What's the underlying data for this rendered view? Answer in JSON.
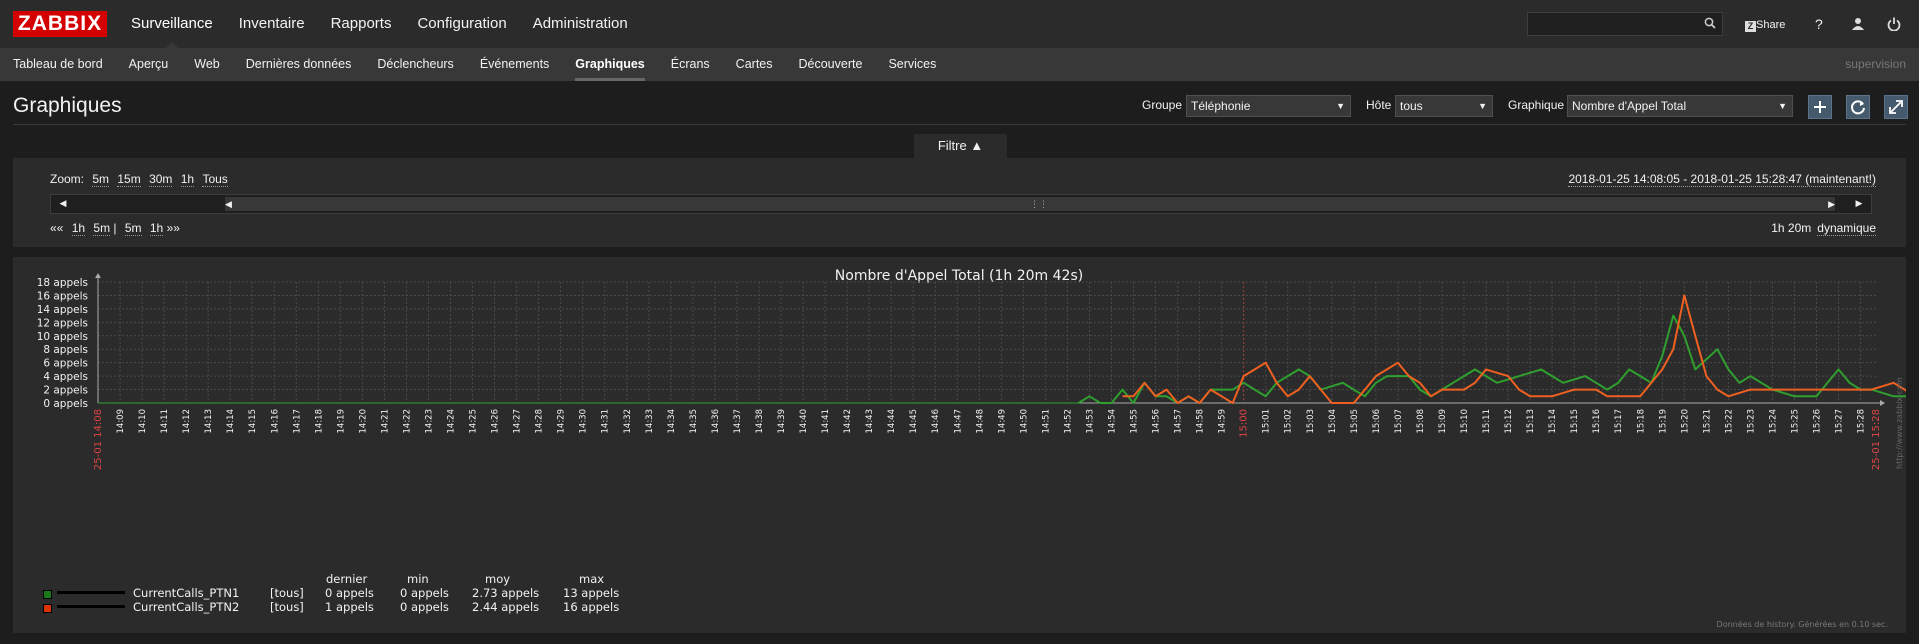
{
  "topbar": {
    "logo": "ZABBIX",
    "menu": [
      "Surveillance",
      "Inventaire",
      "Rapports",
      "Configuration",
      "Administration"
    ],
    "share": "Share",
    "help": "?"
  },
  "submenu": {
    "items": [
      "Tableau de bord",
      "Aperçu",
      "Web",
      "Dernières données",
      "Déclencheurs",
      "Événements",
      "Graphiques",
      "Écrans",
      "Cartes",
      "Découverte",
      "Services"
    ],
    "active": "Graphiques",
    "user": "supervision"
  },
  "header": {
    "title": "Graphiques",
    "group_label": "Groupe",
    "group_value": "Téléphonie",
    "host_label": "Hôte",
    "host_value": "tous",
    "graph_label": "Graphique",
    "graph_value": "Nombre d'Appel Total"
  },
  "filter": {
    "tab_label": "Filtre ▲",
    "zoom_label": "Zoom:",
    "zoom": [
      "5m",
      "15m",
      "30m",
      "1h",
      "Tous"
    ],
    "period": "2018-01-25 14:08:05 - 2018-01-25 15:28:47 (maintenant!)",
    "nav_back": "«« ",
    "nav_left": [
      "1h",
      "5m"
    ],
    "nav_sep": " | ",
    "nav_right": [
      "5m",
      "1h"
    ],
    "nav_fwd": " »»",
    "duration": "1h 20m",
    "mode": "dynamique"
  },
  "chart_data": {
    "type": "line",
    "title": "Nombre d'Appel Total (1h 20m 42s)",
    "y_unit": "appels",
    "ylim": [
      0,
      18
    ],
    "y_ticks": [
      "0 appels",
      "2 appels",
      "4 appels",
      "6 appels",
      "8 appels",
      "10 appels",
      "12 appels",
      "14 appels",
      "16 appels",
      "18 appels"
    ],
    "x_start_label": "25-01 14:08",
    "x_end_label": "25-01 15:28",
    "x_ticks": [
      "14:09",
      "14:10",
      "14:11",
      "14:12",
      "14:13",
      "14:14",
      "14:15",
      "14:16",
      "14:17",
      "14:18",
      "14:19",
      "14:20",
      "14:21",
      "14:22",
      "14:23",
      "14:24",
      "14:25",
      "14:26",
      "14:27",
      "14:28",
      "14:29",
      "14:30",
      "14:31",
      "14:32",
      "14:33",
      "14:34",
      "14:35",
      "14:36",
      "14:37",
      "14:38",
      "14:39",
      "14:40",
      "14:41",
      "14:42",
      "14:43",
      "14:44",
      "14:45",
      "14:46",
      "14:47",
      "14:48",
      "14:49",
      "14:50",
      "14:51",
      "14:52",
      "14:53",
      "14:54",
      "14:55",
      "14:56",
      "14:57",
      "14:58",
      "14:59",
      "15:00",
      "15:01",
      "15:02",
      "15:03",
      "15:04",
      "15:05",
      "15:06",
      "15:07",
      "15:08",
      "15:09",
      "15:10",
      "15:11",
      "15:12",
      "15:13",
      "15:14",
      "15:15",
      "15:16",
      "15:17",
      "15:18",
      "15:19",
      "15:20",
      "15:21",
      "15:22",
      "15:23",
      "15:24",
      "15:25",
      "15:26",
      "15:27",
      "15:28"
    ],
    "highlight_tick": "15:00",
    "grid": true,
    "watermark": "http://www.zabbix.com",
    "series": [
      {
        "name": "CurrentCalls_PTN1",
        "color": "#2f9f2f",
        "points": [
          [
            44.5,
            0
          ],
          [
            45,
            1
          ],
          [
            45.5,
            0
          ],
          [
            46,
            0
          ],
          [
            46.5,
            2
          ],
          [
            47,
            0
          ],
          [
            47.5,
            3
          ],
          [
            48,
            1
          ],
          [
            48.5,
            1
          ],
          [
            49,
            0
          ],
          [
            49.5,
            1
          ],
          [
            50,
            0
          ],
          [
            50.5,
            2
          ],
          [
            51,
            2
          ],
          [
            51.5,
            2
          ],
          [
            52,
            3
          ],
          [
            52.5,
            2
          ],
          [
            53,
            1
          ],
          [
            53.5,
            3
          ],
          [
            54,
            4
          ],
          [
            54.5,
            5
          ],
          [
            55,
            4
          ],
          [
            55.5,
            2
          ],
          [
            56,
            2.5
          ],
          [
            56.5,
            3
          ],
          [
            57,
            2
          ],
          [
            57.5,
            1
          ],
          [
            58,
            3
          ],
          [
            58.5,
            4
          ],
          [
            59,
            4
          ],
          [
            59.5,
            4
          ],
          [
            60,
            2
          ],
          [
            60.5,
            1
          ],
          [
            61,
            2
          ],
          [
            61.5,
            3
          ],
          [
            62,
            4
          ],
          [
            62.5,
            5
          ],
          [
            63,
            4
          ],
          [
            63.5,
            3
          ],
          [
            64,
            3.5
          ],
          [
            64.5,
            4
          ],
          [
            65,
            4.5
          ],
          [
            65.5,
            5
          ],
          [
            66,
            4
          ],
          [
            66.5,
            3
          ],
          [
            67,
            3.5
          ],
          [
            67.5,
            4
          ],
          [
            68,
            3
          ],
          [
            68.5,
            2
          ],
          [
            69,
            3
          ],
          [
            69.5,
            5
          ],
          [
            70,
            4
          ],
          [
            70.5,
            3
          ],
          [
            71,
            7
          ],
          [
            71.5,
            13
          ],
          [
            72,
            10
          ],
          [
            72.5,
            5
          ],
          [
            73,
            6.5
          ],
          [
            73.5,
            8
          ],
          [
            74,
            5
          ],
          [
            74.5,
            3
          ],
          [
            75,
            4
          ],
          [
            75.5,
            3
          ],
          [
            76,
            2
          ],
          [
            76.5,
            1.5
          ],
          [
            77,
            1
          ],
          [
            77.5,
            1
          ],
          [
            78,
            1
          ],
          [
            78.5,
            3
          ],
          [
            79,
            5
          ],
          [
            79.5,
            3
          ],
          [
            80,
            2
          ],
          [
            80.5,
            2
          ],
          [
            81,
            1.5
          ],
          [
            81.5,
            1
          ],
          [
            82,
            1
          ],
          [
            82.5,
            1
          ],
          [
            83,
            2
          ],
          [
            83.5,
            4
          ],
          [
            84,
            7
          ],
          [
            84.5,
            6
          ],
          [
            85,
            5
          ],
          [
            85.5,
            4
          ],
          [
            86,
            2
          ],
          [
            86.5,
            1
          ],
          [
            87,
            1
          ]
        ]
      },
      {
        "name": "CurrentCalls_PTN2",
        "color": "#f06020",
        "points": [
          [
            46.5,
            1
          ],
          [
            47,
            1
          ],
          [
            47.5,
            3
          ],
          [
            48,
            1
          ],
          [
            48.5,
            2
          ],
          [
            49,
            0
          ],
          [
            49.5,
            1
          ],
          [
            50,
            0
          ],
          [
            50.5,
            2
          ],
          [
            51,
            1
          ],
          [
            51.5,
            0
          ],
          [
            52,
            4
          ],
          [
            52.5,
            5
          ],
          [
            53,
            6
          ],
          [
            53.5,
            3
          ],
          [
            54,
            1
          ],
          [
            54.5,
            2
          ],
          [
            55,
            4
          ],
          [
            55.5,
            2
          ],
          [
            56,
            0
          ],
          [
            56.5,
            0
          ],
          [
            57,
            0
          ],
          [
            57.5,
            2
          ],
          [
            58,
            4
          ],
          [
            58.5,
            5
          ],
          [
            59,
            6
          ],
          [
            59.5,
            4
          ],
          [
            60,
            3
          ],
          [
            60.5,
            1
          ],
          [
            61,
            2
          ],
          [
            61.5,
            2
          ],
          [
            62,
            2
          ],
          [
            62.5,
            3
          ],
          [
            63,
            5
          ],
          [
            63.5,
            4.5
          ],
          [
            64,
            4
          ],
          [
            64.5,
            2
          ],
          [
            65,
            1
          ],
          [
            65.5,
            1
          ],
          [
            66,
            1
          ],
          [
            66.5,
            1.5
          ],
          [
            67,
            2
          ],
          [
            67.5,
            2
          ],
          [
            68,
            2
          ],
          [
            68.5,
            1
          ],
          [
            69,
            1
          ],
          [
            69.5,
            1
          ],
          [
            70,
            1
          ],
          [
            70.5,
            3
          ],
          [
            71,
            5
          ],
          [
            71.5,
            8
          ],
          [
            72,
            16
          ],
          [
            72.5,
            10
          ],
          [
            73,
            4
          ],
          [
            73.5,
            2
          ],
          [
            74,
            1
          ],
          [
            74.5,
            1.5
          ],
          [
            75,
            2
          ],
          [
            75.5,
            2
          ],
          [
            76,
            2
          ],
          [
            76.5,
            2
          ],
          [
            77,
            2
          ],
          [
            77.5,
            2
          ],
          [
            78,
            2
          ],
          [
            78.5,
            2
          ],
          [
            79,
            2
          ],
          [
            79.5,
            2
          ],
          [
            80,
            2
          ],
          [
            80.5,
            2
          ],
          [
            81,
            2.5
          ],
          [
            81.5,
            3
          ],
          [
            82,
            2
          ],
          [
            82.5,
            1
          ],
          [
            83,
            1.5
          ],
          [
            83.5,
            2
          ],
          [
            84,
            3
          ],
          [
            84.5,
            4
          ],
          [
            85,
            4
          ],
          [
            85.5,
            4
          ],
          [
            86,
            2
          ],
          [
            86.5,
            0
          ],
          [
            87,
            0.5
          ],
          [
            87.5,
            1
          ],
          [
            88,
            1
          ]
        ]
      }
    ],
    "legend_headers": [
      "dernier",
      "min",
      "moy",
      "max"
    ],
    "legend": [
      {
        "name": "CurrentCalls_PTN1",
        "scope": "[tous]",
        "dernier": "0 appels",
        "min": "0 appels",
        "moy": "2.73 appels",
        "max": "13 appels",
        "color": "#1a7a1a"
      },
      {
        "name": "CurrentCalls_PTN2",
        "scope": "[tous]",
        "dernier": "1 appels",
        "min": "0 appels",
        "moy": "2.44 appels",
        "max": "16 appels",
        "color": "#dd3300"
      }
    ],
    "footer": "Données de history. Générées en 0.10 sec."
  }
}
